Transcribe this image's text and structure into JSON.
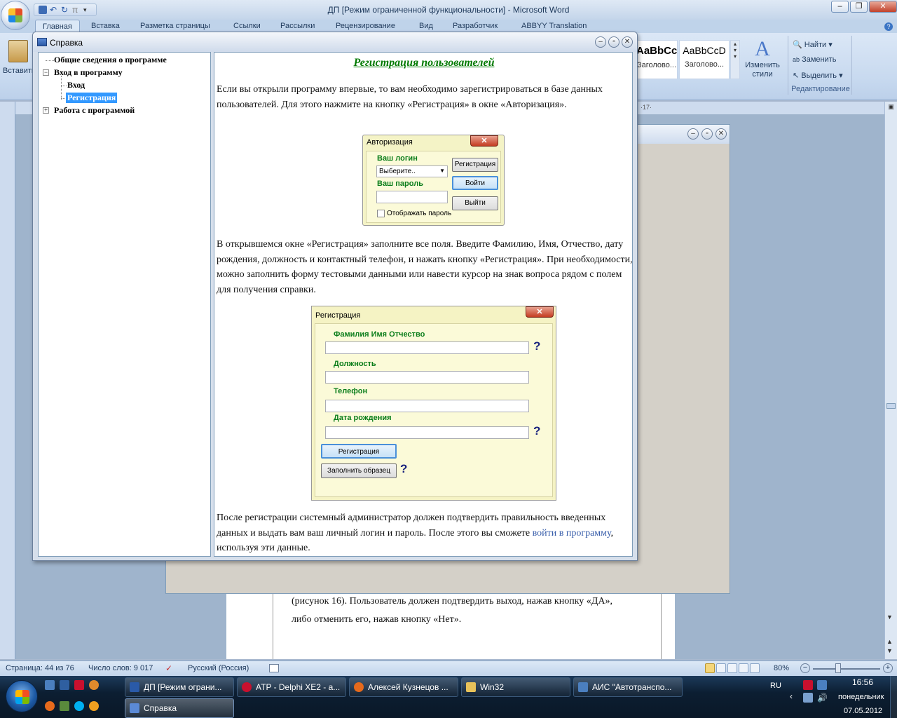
{
  "word": {
    "title": "ДП [Режим ограниченной функциональности] - Microsoft Word",
    "tabs": [
      "Главная",
      "Вставка",
      "Разметка страницы",
      "Ссылки",
      "Рассылки",
      "Рецензирование",
      "Вид",
      "Разработчик",
      "ABBYY Translation"
    ],
    "ribbon": {
      "paste_label": "Вставить",
      "style1_sample": "AaBbCc",
      "style1_name": "Заголово...",
      "style2_sample": "AaBbCcD",
      "style2_name": "Заголово...",
      "change_styles": "Изменить стили",
      "find": "Найти",
      "replace": "Заменить",
      "select": "Выделить",
      "editing_group": "Редактирование",
      "indent_hint": "·17·"
    },
    "page_text": {
      "line1": "(рисунок 16). Пользователь должен подтвердить выход, нажав кнопку «ДА»,",
      "line2": "либо отменить его, нажав кнопку «Нет»."
    },
    "status": {
      "page": "Страница: 44 из 76",
      "words": "Число слов: 9 017",
      "language": "Русский (Россия)",
      "zoom": "80%"
    }
  },
  "help": {
    "title": "Справка",
    "tree": {
      "item1": "Общие сведения о программе",
      "item2": "Вход в программу",
      "item2_child1": "Вход",
      "item2_child2": "Регистрация",
      "item3": "Работа с программой"
    },
    "content": {
      "heading": "Регистрация пользователей",
      "p1": "Если вы открыли программу впервые, то вам необходимо зарегистрироваться в базе данных пользователей. Для этого нажмите на кнопку «Регистрация» в окне «Авторизация».",
      "p2": "В открывшемся окне «Регистрация» заполните все поля. Введите Фамилию, Имя, Отчество, дату рождения, должность и контактный телефон, и нажать кнопку «Регистрация». При необходимости, можно заполнить форму тестовыми данными или навести курсор на знак вопроса рядом с полем для получения справки.",
      "p3_before": "После регистрации системный администратор должен подтвердить правильность введенных данных и выдать вам ваш личный логин и пароль. После этого вы сможете ",
      "p3_link": "войти в программу",
      "p3_after": ", используя эти данные."
    },
    "auth_form": {
      "title": "Авторизация",
      "login_label": "Ваш логин",
      "login_value": "Выберите..",
      "password_label": "Ваш пароль",
      "show_password": "Отображать пароль",
      "btn_register": "Регистрация",
      "btn_login": "Войти",
      "btn_exit": "Выйти"
    },
    "reg_form": {
      "title": "Регистрация",
      "fio_label": "Фамилия Имя Отчество",
      "position_label": "Должность",
      "phone_label": "Телефон",
      "birth_label": "Дата рождения",
      "btn_register": "Регистрация",
      "btn_fill": "Заполнить образец",
      "help_mark": "?"
    }
  },
  "taskbar": {
    "items": [
      "ДП [Режим ограни...",
      "ATP - Delphi XE2 - a...",
      "Алексей Кузнецов ...",
      "Win32",
      "АИС \"Автотранспо...",
      "Справка"
    ],
    "lang": "RU",
    "time": "16:56",
    "day": "понедельник",
    "date": "07.05.2012"
  }
}
